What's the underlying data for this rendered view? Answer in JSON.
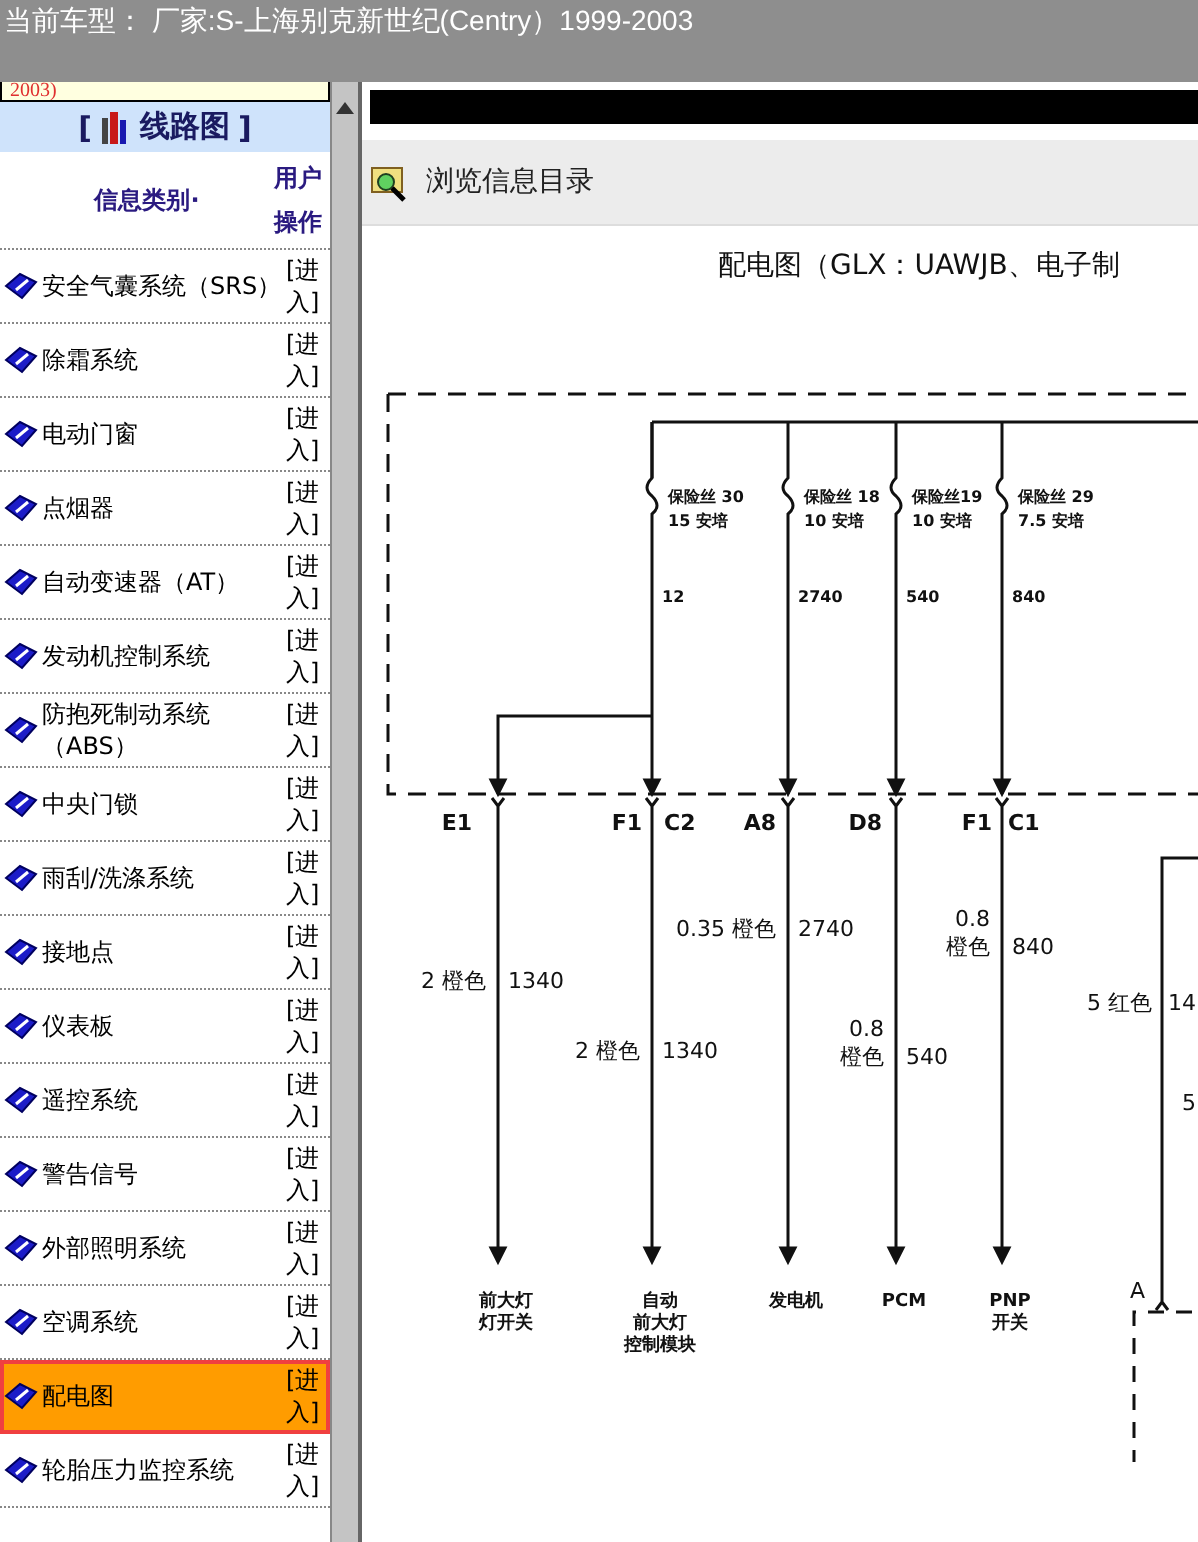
{
  "window": {
    "title": "当前车型： 厂家:S-上海别克新世纪(Centry）1999-2003"
  },
  "sidebar": {
    "top_note": "2003)",
    "header": {
      "open": "[",
      "title": "线路图",
      "close": "]"
    },
    "columns": [
      "信息类别·",
      "用户操作"
    ],
    "items": [
      {
        "label": "安全气囊系统（SRS）",
        "action": "[进入]",
        "selected": false
      },
      {
        "label": "除霜系统",
        "action": "[进入]",
        "selected": false
      },
      {
        "label": "电动门窗",
        "action": "[进入]",
        "selected": false
      },
      {
        "label": "点烟器",
        "action": "[进入]",
        "selected": false
      },
      {
        "label": "自动变速器（AT）",
        "action": "[进入]",
        "selected": false
      },
      {
        "label": "发动机控制系统",
        "action": "[进入]",
        "selected": false
      },
      {
        "label": "防抱死制动系统（ABS）",
        "action": "[进入]",
        "selected": false
      },
      {
        "label": "中央门锁",
        "action": "[进入]",
        "selected": false
      },
      {
        "label": "雨刮/洗涤系统",
        "action": "[进入]",
        "selected": false
      },
      {
        "label": "接地点",
        "action": "[进入]",
        "selected": false
      },
      {
        "label": "仪表板",
        "action": "[进入]",
        "selected": false
      },
      {
        "label": "遥控系统",
        "action": "[进入]",
        "selected": false
      },
      {
        "label": "警告信号",
        "action": "[进入]",
        "selected": false
      },
      {
        "label": "外部照明系统",
        "action": "[进入]",
        "selected": false
      },
      {
        "label": "空调系统",
        "action": "[进入]",
        "selected": false
      },
      {
        "label": "配电图",
        "action": "[进入]",
        "selected": true
      },
      {
        "label": "轮胎压力监控系统",
        "action": "[进入]",
        "selected": false
      }
    ]
  },
  "browse_bar": {
    "label": "浏览信息目录"
  },
  "diagram": {
    "title": "配电图（GLX：UAWJB、电子制",
    "fuses": [
      {
        "name": "保险丝 30",
        "rating": "15 安培",
        "wire": "12"
      },
      {
        "name": "保险丝 18",
        "rating": "10 安培",
        "wire": "2740"
      },
      {
        "name": "保险丝19",
        "rating": "10 安培",
        "wire": "540"
      },
      {
        "name": "保险丝 29",
        "rating": "7.5 安培",
        "wire": "840"
      }
    ],
    "pins": [
      "E1",
      "F1",
      "C2",
      "A8",
      "D8",
      "F1",
      "C1"
    ],
    "wires": [
      {
        "gauge": [
          "2 橙色"
        ],
        "circuit": "1340",
        "destination": [
          "前大灯",
          "灯开关"
        ]
      },
      {
        "gauge": [
          "2 橙色"
        ],
        "circuit": "1340",
        "destination": [
          "自动",
          "前大灯",
          "控制模块"
        ]
      },
      {
        "gauge": [
          "0.35 橙色"
        ],
        "circuit": "2740",
        "destination": [
          "发电机"
        ]
      },
      {
        "gauge": [
          "0.8",
          "橙色"
        ],
        "circuit": "540",
        "destination": [
          "PCM"
        ]
      },
      {
        "gauge": [
          "0.8",
          "橙色"
        ],
        "circuit": "840",
        "destination": [
          "PNP",
          "开关"
        ]
      }
    ],
    "partial_wire": {
      "gauge": "5 红色",
      "circuit": "14",
      "note": "5",
      "connector": "A"
    }
  }
}
